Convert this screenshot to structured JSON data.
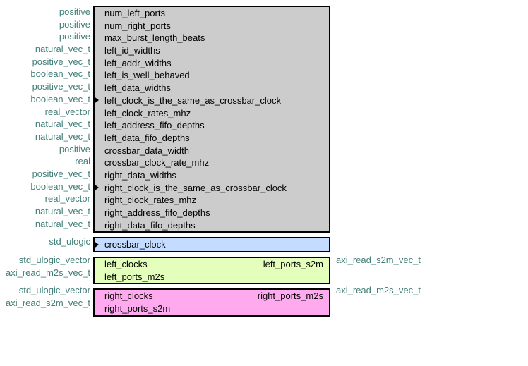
{
  "generics": [
    {
      "type": "positive",
      "name": "num_left_ports",
      "caret": false
    },
    {
      "type": "positive",
      "name": "num_right_ports",
      "caret": false
    },
    {
      "type": "positive",
      "name": "max_burst_length_beats",
      "caret": false
    },
    {
      "type": "natural_vec_t",
      "name": "left_id_widths",
      "caret": false
    },
    {
      "type": "positive_vec_t",
      "name": "left_addr_widths",
      "caret": false
    },
    {
      "type": "boolean_vec_t",
      "name": "left_is_well_behaved",
      "caret": false
    },
    {
      "type": "positive_vec_t",
      "name": "left_data_widths",
      "caret": false
    },
    {
      "type": "boolean_vec_t",
      "name": "left_clock_is_the_same_as_crossbar_clock",
      "caret": true
    },
    {
      "type": "real_vector",
      "name": "left_clock_rates_mhz",
      "caret": false
    },
    {
      "type": "natural_vec_t",
      "name": "left_address_fifo_depths",
      "caret": false
    },
    {
      "type": "natural_vec_t",
      "name": "left_data_fifo_depths",
      "caret": false
    },
    {
      "type": "positive",
      "name": "crossbar_data_width",
      "caret": false
    },
    {
      "type": "real",
      "name": "crossbar_clock_rate_mhz",
      "caret": false
    },
    {
      "type": "positive_vec_t",
      "name": "right_data_widths",
      "caret": false
    },
    {
      "type": "boolean_vec_t",
      "name": "right_clock_is_the_same_as_crossbar_clock",
      "caret": true
    },
    {
      "type": "real_vector",
      "name": "right_clock_rates_mhz",
      "caret": false
    },
    {
      "type": "natural_vec_t",
      "name": "right_address_fifo_depths",
      "caret": false
    },
    {
      "type": "natural_vec_t",
      "name": "right_data_fifo_depths",
      "caret": false
    }
  ],
  "clock_port": {
    "left_type": "std_ulogic",
    "name": "crossbar_clock"
  },
  "left_ports": [
    {
      "left_type": "std_ulogic_vector",
      "lname": "left_clocks",
      "rname": "left_ports_s2m",
      "right_type": "axi_read_s2m_vec_t"
    },
    {
      "left_type": "axi_read_m2s_vec_t",
      "lname": "left_ports_m2s",
      "rname": "",
      "right_type": ""
    }
  ],
  "right_ports": [
    {
      "left_type": "std_ulogic_vector",
      "lname": "right_clocks",
      "rname": "right_ports_m2s",
      "right_type": "axi_read_m2s_vec_t"
    },
    {
      "left_type": "axi_read_s2m_vec_t",
      "lname": "right_ports_s2m",
      "rname": "",
      "right_type": ""
    }
  ]
}
